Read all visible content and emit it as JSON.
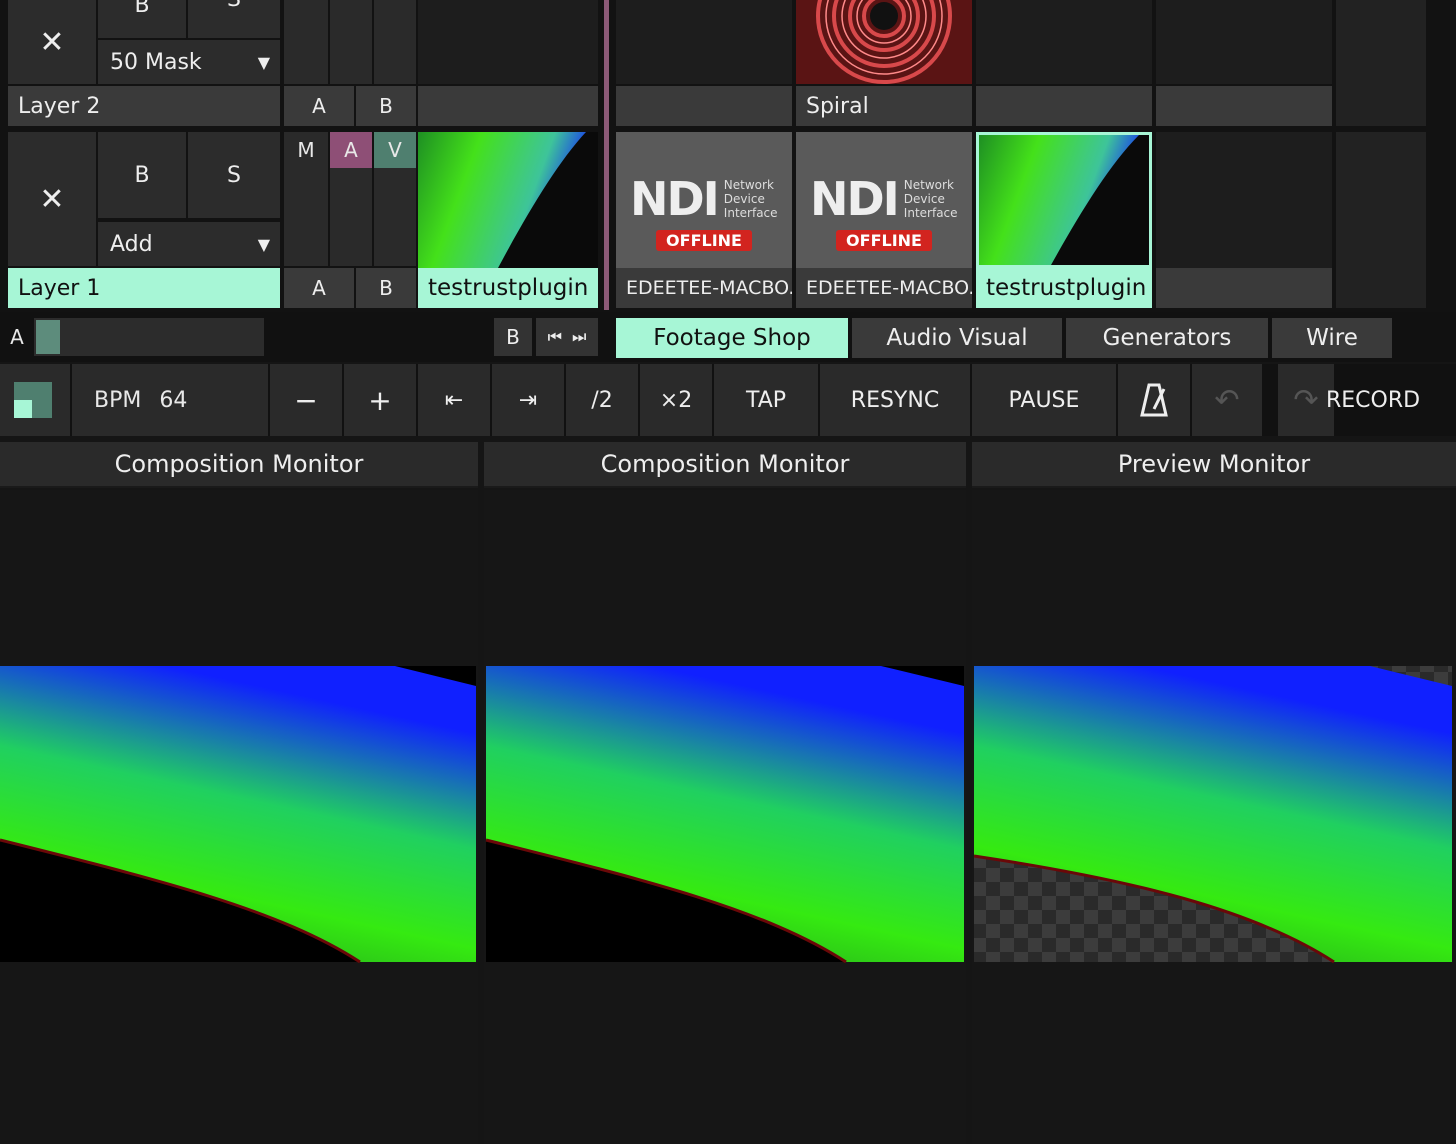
{
  "colors": {
    "accent": "#a7f6d6",
    "layer_active": "#a7f6d6",
    "audio_badge": "#8e4f76",
    "video_badge": "#4f7f6f",
    "divider": "#8c5a77",
    "ndi_red": "#d2241f"
  },
  "layer2": {
    "name": "Layer 2",
    "b_label": "B",
    "s_label": "S",
    "blend": "50 Mask",
    "a_label": "A",
    "b2_label": "B",
    "clips": [
      {
        "name": "Spiral"
      }
    ]
  },
  "layer1": {
    "name": "Layer 1",
    "b_label": "B",
    "s_label": "S",
    "blend": "Add",
    "m_label": "M",
    "a_label": "A",
    "v_label": "V",
    "a2_label": "A",
    "b2_label": "B",
    "clips": [
      {
        "name": "testrustplugin"
      },
      {
        "name": "EDEETEE-MACBO..."
      },
      {
        "name": "EDEETEE-MACBO..."
      },
      {
        "name": "testrustplugin"
      }
    ]
  },
  "ndi": {
    "logo": "NDI",
    "sub1": "Network",
    "sub2": "Device",
    "sub3": "Interface",
    "offline": "OFFLINE"
  },
  "crossfader": {
    "a_label": "A",
    "b_label": "B",
    "value": 0.1
  },
  "browser_tabs": [
    {
      "label": "Footage Shop",
      "active": true
    },
    {
      "label": "Audio Visual",
      "active": false
    },
    {
      "label": "Generators",
      "active": false
    },
    {
      "label": "Wire",
      "active": false
    }
  ],
  "tempo": {
    "bpm_label": "BPM",
    "bpm_value": "64",
    "minus": "−",
    "plus": "+",
    "nudge_back": "⇤",
    "nudge_fwd": "⇥",
    "half": "/2",
    "double": "×2",
    "tap": "TAP",
    "resync": "RESYNC",
    "pause": "PAUSE",
    "record": "RECORD"
  },
  "monitors": [
    {
      "title": "Composition Monitor"
    },
    {
      "title": "Composition Monitor"
    },
    {
      "title": "Preview Monitor"
    }
  ],
  "icons": [
    "close-icon",
    "dropdown-arrow-icon",
    "skip-start-icon",
    "skip-end-icon",
    "metronome-icon",
    "undo-icon",
    "redo-icon"
  ]
}
